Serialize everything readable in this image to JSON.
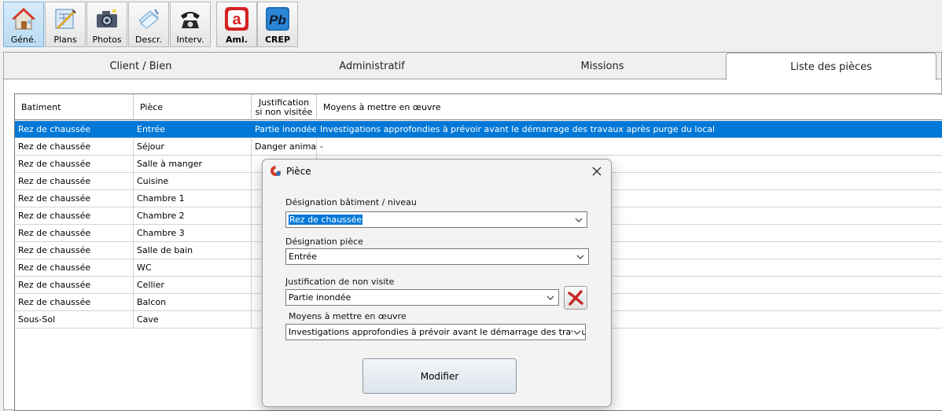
{
  "toolbar": {
    "buttons": [
      {
        "label": "Géné.",
        "icon": "home-icon",
        "active": true
      },
      {
        "label": "Plans",
        "icon": "plans-icon"
      },
      {
        "label": "Photos",
        "icon": "camera-icon"
      },
      {
        "label": "Descr.",
        "icon": "description-icon"
      },
      {
        "label": "Interv.",
        "icon": "telephone-icon"
      },
      {
        "label": "Ami.",
        "icon": "ami-app-icon",
        "glyph": "a"
      },
      {
        "label": "CREP",
        "icon": "crep-app-icon",
        "glyph": "Pb"
      }
    ]
  },
  "tabs": [
    {
      "label": "Client / Bien"
    },
    {
      "label": "Administratif"
    },
    {
      "label": "Missions"
    },
    {
      "label": "Liste des pièces",
      "active": true
    }
  ],
  "grid": {
    "headers": [
      "Batiment",
      "Pièce",
      "Justification",
      "si non visitée",
      "Moyens à mettre en œuvre"
    ],
    "rows": [
      {
        "batiment": "Rez de chaussée",
        "piece": "Entrée",
        "justification": "Partie inondée",
        "moyens": "Investigations approfondies à prévoir avant le démarrage des travaux après purge du local",
        "selected": true
      },
      {
        "batiment": "Rez de chaussée",
        "piece": "Séjour",
        "justification": "Danger animal",
        "moyens": "-"
      },
      {
        "batiment": "Rez de chaussée",
        "piece": "Salle à manger",
        "justification": "",
        "moyens": ""
      },
      {
        "batiment": "Rez de chaussée",
        "piece": "Cuisine",
        "justification": "",
        "moyens": ""
      },
      {
        "batiment": "Rez de chaussée",
        "piece": "Chambre 1",
        "justification": "",
        "moyens": ""
      },
      {
        "batiment": "Rez de chaussée",
        "piece": "Chambre 2",
        "justification": "",
        "moyens": ""
      },
      {
        "batiment": "Rez de chaussée",
        "piece": "Chambre 3",
        "justification": "",
        "moyens": ""
      },
      {
        "batiment": "Rez de chaussée",
        "piece": "Salle de bain",
        "justification": "",
        "moyens": ""
      },
      {
        "batiment": "Rez de chaussée",
        "piece": "WC",
        "justification": "",
        "moyens": ""
      },
      {
        "batiment": "Rez de chaussée",
        "piece": "Cellier",
        "justification": "",
        "moyens": ""
      },
      {
        "batiment": "Rez de chaussée",
        "piece": "Balcon",
        "justification": "",
        "moyens": ""
      },
      {
        "batiment": "Sous-Sol",
        "piece": "Cave",
        "justification": "",
        "moyens": ""
      }
    ]
  },
  "dialog": {
    "title": "Pièce",
    "batiment_label": "Désignation bâtiment / niveau",
    "batiment_value": "Rez de chaussée",
    "piece_label": "Désignation pièce",
    "piece_value": "Entrée",
    "justification_label": "Justification de non visite",
    "justification_value": "Partie inondée",
    "moyens_label": "Moyens à mettre en œuvre",
    "moyens_value": "Investigations approfondies à prévoir avant le démarrage des travaux après purge du local",
    "modify_label": "Modifier",
    "colors": {
      "selection": "#0078d7",
      "clear_icon": "#c62828"
    }
  }
}
